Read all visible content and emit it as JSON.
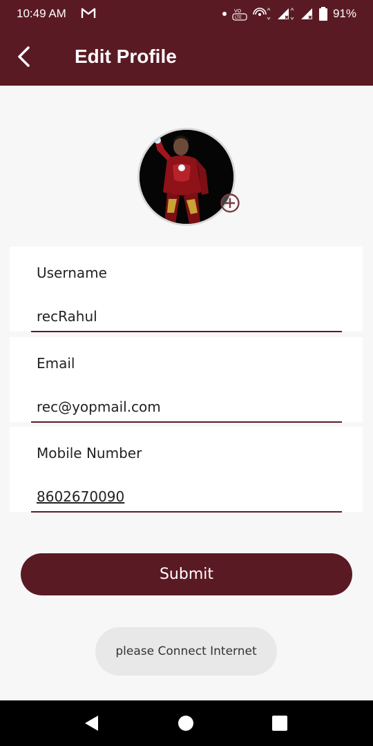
{
  "status_bar": {
    "time": "10:49 AM",
    "battery": "91%",
    "icons": [
      "gmail-icon",
      "notification-dot-icon",
      "volte-icon",
      "hotspot-icon",
      "signal-icon",
      "signal-icon",
      "battery-icon"
    ]
  },
  "app_bar": {
    "title": "Edit Profile",
    "back_icon": "chevron-left-icon"
  },
  "profile": {
    "avatar_icon": "avatar-image",
    "add_photo_icon": "plus-circle-icon"
  },
  "form": {
    "fields": [
      {
        "label": "Username",
        "value": "recRahul"
      },
      {
        "label": "Email",
        "value": "rec@yopmail.com"
      },
      {
        "label": "Mobile Number",
        "value": "8602670090"
      }
    ]
  },
  "submit": {
    "label": "Submit"
  },
  "toast": {
    "text": "please Connect Internet"
  },
  "nav_bar": {
    "icons": [
      "back-triangle-icon",
      "home-circle-icon",
      "recents-square-icon"
    ]
  },
  "colors": {
    "primary": "#5a1a24",
    "background": "#f7f7f7",
    "cursor": "#e8622a"
  }
}
